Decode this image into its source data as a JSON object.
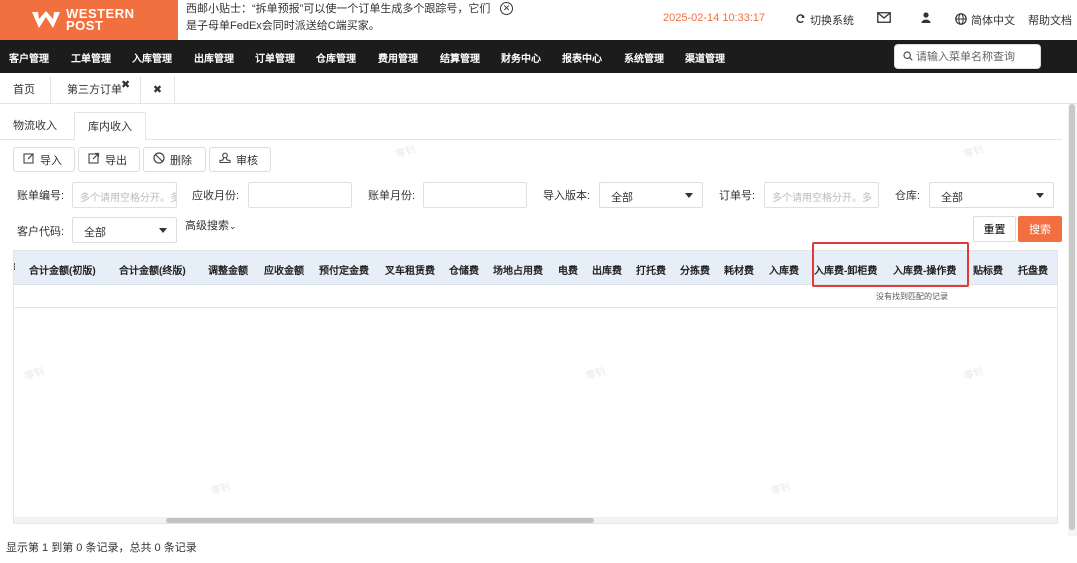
{
  "brand": {
    "line1": "WESTERN",
    "line2": "POST",
    "color": "#f26f3f"
  },
  "tip": {
    "line1": "西邮小贴士：“拆单预报”可以使一个订单生成多个跟踪号，它们",
    "line2": "是子母单FedEx会同时派送给C端买家。"
  },
  "header": {
    "datetime": "2025-02-14 10:33:17",
    "switch_system": "切换系统",
    "language": "简体中文",
    "help": "帮助文档"
  },
  "nav": {
    "items": [
      "客户管理",
      "工单管理",
      "入库管理",
      "出库管理",
      "订单管理",
      "仓库管理",
      "费用管理",
      "结算管理",
      "财务中心",
      "报表中心",
      "系统管理",
      "渠道管理"
    ],
    "search_placeholder": "请输入菜单名称查询"
  },
  "page_tabs": {
    "home": "首页",
    "current": "第三方订单"
  },
  "sub_tabs": [
    "物流收入",
    "库内收入"
  ],
  "toolbar": {
    "import": "导入",
    "export": "导出",
    "delete": "删除",
    "review": "审核"
  },
  "filters": {
    "bill_no_label": "账单编号:",
    "bill_no_placeholder": "多个请用空格分开。多",
    "ar_month_label": "应收月份:",
    "bill_month_label": "账单月份:",
    "import_version_label": "导入版本:",
    "import_version_value": "全部",
    "order_no_label": "订单号:",
    "order_no_placeholder": "多个请用空格分开。多",
    "warehouse_label": "仓库:",
    "warehouse_value": "全部",
    "customer_code_label": "客户代码:",
    "customer_code_value": "全部",
    "advanced": "高级搜索",
    "reset": "重置",
    "search": "搜索"
  },
  "table": {
    "columns": [
      "合计金额(初版)",
      "合计金额(终版)",
      "调整金额",
      "应收金额",
      "预付定金费",
      "叉车租赁费",
      "仓储费",
      "场地占用费",
      "电费",
      "出库费",
      "打托费",
      "分拣费",
      "耗材费",
      "入库费",
      "入库费-卸柜费",
      "入库费-操作费",
      "贴标费",
      "托盘费"
    ],
    "empty_text": "没有找到匹配的记录"
  },
  "footer": {
    "summary": "显示第 1 到第 0 条记录，总共 0 条记录"
  },
  "watermark": "零钊"
}
